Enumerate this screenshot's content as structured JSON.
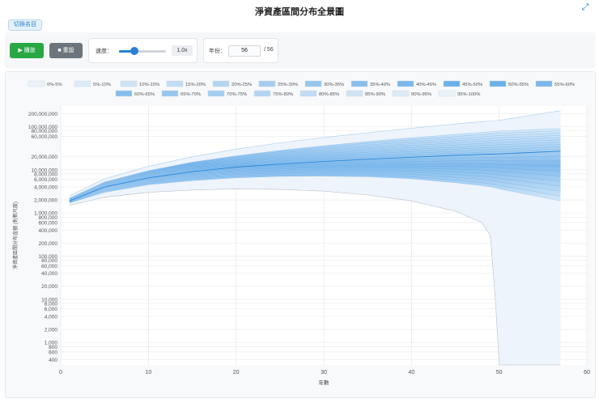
{
  "header": {
    "title": "淨資產區間分布全景圖",
    "toggle_label": "切換名目",
    "expand_icon": "expand-icon"
  },
  "controls": {
    "play_label": "▶ 播放",
    "reset_label": "■ 重設",
    "speed_label": "速度：",
    "speed_value": "1.0x",
    "speed_fraction": 0.32,
    "year_label": "年份：",
    "year_value": "56",
    "year_total": "/ 56"
  },
  "chart_data": {
    "type": "area",
    "xlabel": "年數",
    "ylabel": "淨資產區間分布金額 (對數尺度)",
    "xlim": [
      0,
      60
    ],
    "x_ticks": [
      0,
      10,
      20,
      30,
      40,
      50,
      60
    ],
    "y_scale": "log",
    "ylim": [
      300,
      300000000
    ],
    "y_ticks": [
      {
        "v": 400,
        "label": "400"
      },
      {
        "v": 600,
        "label": "600"
      },
      {
        "v": 800,
        "label": "800"
      },
      {
        "v": 1000,
        "label": "1,000"
      },
      {
        "v": 2000,
        "label": "2,000"
      },
      {
        "v": 4000,
        "label": "4,000"
      },
      {
        "v": 6000,
        "label": "6,000"
      },
      {
        "v": 8000,
        "label": "8,000"
      },
      {
        "v": 10000,
        "label": "10,000"
      },
      {
        "v": 20000,
        "label": "20,000"
      },
      {
        "v": 40000,
        "label": "40,000"
      },
      {
        "v": 60000,
        "label": "60,000"
      },
      {
        "v": 80000,
        "label": "80,000"
      },
      {
        "v": 100000,
        "label": "100,000"
      },
      {
        "v": 200000,
        "label": "200,000"
      },
      {
        "v": 400000,
        "label": "400,000"
      },
      {
        "v": 600000,
        "label": "600,000"
      },
      {
        "v": 800000,
        "label": "800,000"
      },
      {
        "v": 1000000,
        "label": "1,000,000"
      },
      {
        "v": 2000000,
        "label": "2,000,000"
      },
      {
        "v": 4000000,
        "label": "4,000,000"
      },
      {
        "v": 6000000,
        "label": "6,000,000"
      },
      {
        "v": 8000000,
        "label": "8,000,000"
      },
      {
        "v": 10000000,
        "label": "10,000,000"
      },
      {
        "v": 20000000,
        "label": "20,000,000"
      },
      {
        "v": 60000000,
        "label": "60,000,000"
      },
      {
        "v": 80000000,
        "label": "80,000,000"
      },
      {
        "v": 100000000,
        "label": "100,000,000"
      },
      {
        "v": 200000000,
        "label": "200,000,000"
      }
    ],
    "legend": [
      "0%-5%",
      "5%-10%",
      "10%-15%",
      "15%-20%",
      "20%-25%",
      "25%-30%",
      "30%-35%",
      "35%-40%",
      "40%-45%",
      "45%-50%",
      "50%-55%",
      "55%-60%",
      "60%-65%",
      "65%-70%",
      "70%-75%",
      "75%-80%",
      "80%-85%",
      "85%-90%",
      "90%-95%",
      "95%-100%"
    ],
    "legend_position": "top",
    "grid": true,
    "series_color": "#4a9be0",
    "x": [
      1,
      5,
      10,
      15,
      20,
      25,
      30,
      35,
      40,
      45,
      48,
      49,
      49.6,
      50,
      57
    ],
    "lower_bound": [
      1500000,
      2300000,
      3000000,
      3400000,
      3600000,
      3500000,
      3200000,
      2600000,
      1900000,
      1100000,
      600000,
      300000,
      8000,
      300,
      300
    ],
    "p5_bound": [
      1700000,
      3000000,
      4500000,
      5600000,
      6500000,
      7000000,
      7100000,
      6900000,
      6200000,
      5000000,
      4300000,
      4000000,
      3800000,
      3600000,
      1900000
    ],
    "median": [
      1900000,
      4000000,
      6500000,
      9000000,
      11500000,
      13500000,
      15500000,
      17500000,
      19500000,
      21500000,
      22700000,
      23000000,
      23200000,
      23300000,
      27000000
    ],
    "p95_bound": [
      2200000,
      5200000,
      9500000,
      15000000,
      21000000,
      28000000,
      36000000,
      45000000,
      55000000,
      66000000,
      73000000,
      76000000,
      78000000,
      79000000,
      90000000
    ],
    "upper_bound": [
      2500000,
      6200000,
      12000000,
      20000000,
      30000000,
      42000000,
      56000000,
      72000000,
      92000000,
      115000000,
      130000000,
      135000000,
      138000000,
      140000000,
      235000000
    ]
  }
}
